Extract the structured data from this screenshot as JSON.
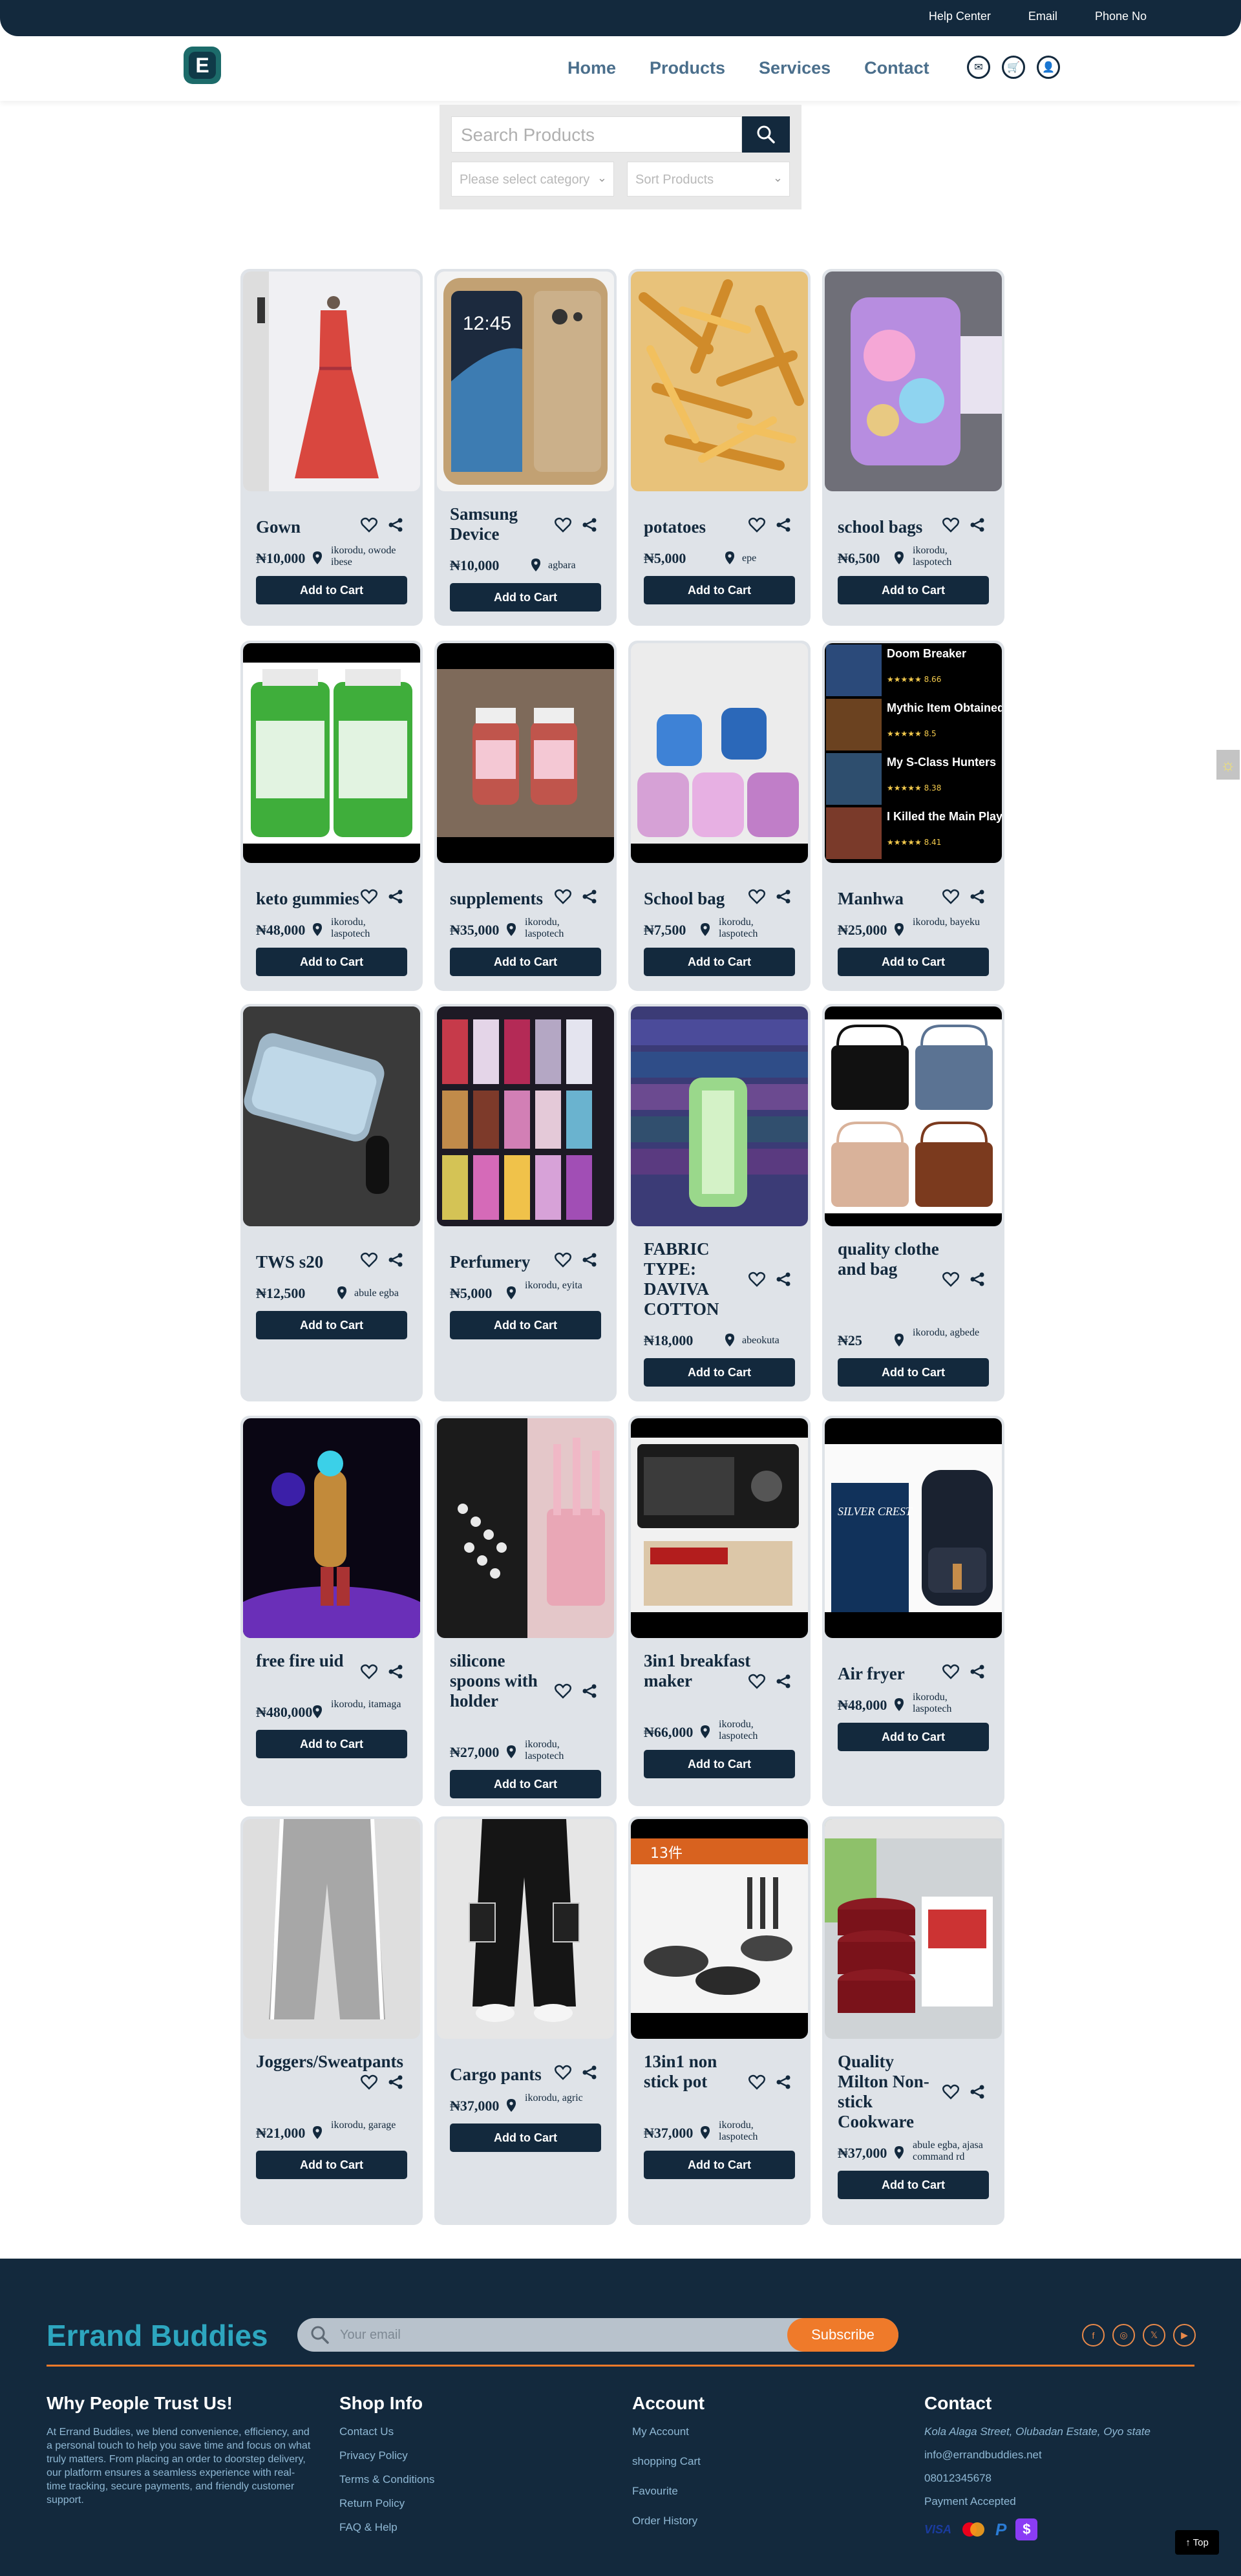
{
  "topbar": {
    "links": [
      "Help Center",
      "Email",
      "Phone No"
    ]
  },
  "nav": {
    "links": [
      "Home",
      "Products",
      "Services",
      "Contact"
    ]
  },
  "search": {
    "placeholder": "Search Products",
    "category_placeholder": "Please select category",
    "sort_placeholder": "Sort Products"
  },
  "products": [
    {
      "name": "Gown",
      "price": "₦10,000",
      "location": "ikorodu, owode ibese",
      "button": "Add to Cart",
      "image": "pink-floral-dress"
    },
    {
      "name": "Samsung Device",
      "price": "₦10,000",
      "location": "agbara",
      "button": "Add to Cart",
      "image": "gold-smartphone"
    },
    {
      "name": "potatoes",
      "price": "₦5,000",
      "location": "epe",
      "button": "Add to Cart",
      "image": "fried-potatoes"
    },
    {
      "name": "school bags",
      "price": "₦6,500",
      "location": "ikorodu, laspotech",
      "button": "Add to Cart",
      "image": "sparkly-school-bag"
    },
    {
      "name": "keto gummies",
      "price": "₦48,000",
      "location": "ikorodu, laspotech",
      "button": "Add to Cart",
      "image": "green-gummy-bottles"
    },
    {
      "name": "supplements",
      "price": "₦35,000",
      "location": "ikorodu, laspotech",
      "button": "Add to Cart",
      "image": "hair-gummy-bottles"
    },
    {
      "name": "School bag",
      "price": "₦7,500",
      "location": "ikorodu, laspotech",
      "button": "Add to Cart",
      "image": "kids-school-bags"
    },
    {
      "name": "Manhwa",
      "price": "₦25,000",
      "location": "ikorodu, bayeku",
      "button": "Add to Cart",
      "image": "manhwa-list"
    },
    {
      "name": "TWS s20",
      "price": "₦12,500",
      "location": "abule egba",
      "button": "Add to Cart",
      "image": "earbuds-case"
    },
    {
      "name": "Perfumery",
      "price": "₦5,000",
      "location": "ikorodu, eyita",
      "button": "Add to Cart",
      "image": "perfume-shelf"
    },
    {
      "name": "FABRIC TYPE: DAVIVA COTTON",
      "price": "₦18,000",
      "location": "abeokuta",
      "button": "Add to Cart",
      "image": "fabric-stack"
    },
    {
      "name": "quality clothe and bag",
      "price": "₦25",
      "location": "ikorodu, agbede",
      "button": "Add to Cart",
      "image": "handbags"
    },
    {
      "name": "free fire uid",
      "price": "₦480,000",
      "location": "ikorodu, itamaga",
      "button": "Add to Cart",
      "image": "game-character"
    },
    {
      "name": "silicone spoons with holder",
      "price": "₦27,000",
      "location": "ikorodu, laspotech",
      "button": "Add to Cart",
      "image": "silicone-utensils"
    },
    {
      "name": "3in1 breakfast maker",
      "price": "₦66,000",
      "location": "ikorodu, laspotech",
      "button": "Add to Cart",
      "image": "breakfast-maker"
    },
    {
      "name": "Air fryer",
      "price": "₦48,000",
      "location": "ikorodu, laspotech",
      "button": "Add to Cart",
      "image": "air-fryer"
    },
    {
      "name": "Joggers/Sweatpants",
      "price": "₦21,000",
      "location": "ikorodu, garage",
      "button": "Add to Cart",
      "image": "grey-joggers"
    },
    {
      "name": "Cargo pants",
      "price": "₦37,000",
      "location": "ikorodu, agric",
      "button": "Add to Cart",
      "image": "black-cargo-pants"
    },
    {
      "name": "13in1 non stick pot",
      "price": "₦37,000",
      "location": "ikorodu, laspotech",
      "button": "Add to Cart",
      "image": "cookware-set"
    },
    {
      "name": "Quality Milton Non-stick Cookware",
      "price": "₦37,000",
      "location": "abule egba, ajasa command rd",
      "button": "Add to Cart",
      "image": "red-cookware"
    }
  ],
  "manhwa_titles": [
    "Doom Breaker",
    "Mythic Item Obtained",
    "My S-Class Hunters",
    "I Killed the Main Player"
  ],
  "manhwa_ratings": [
    "8.66",
    "8.5",
    "8.38",
    "8.41"
  ],
  "footer": {
    "brand": "Errand Buddies",
    "email_placeholder": "Your email",
    "subscribe": "Subscribe",
    "trust_title": "Why People Trust Us!",
    "trust_text": "At Errand Buddies, we blend convenience, efficiency, and a personal touch to help you save time and focus on what truly matters. From placing an order to doorstep delivery, our platform ensures a seamless experience with real-time tracking, secure payments, and friendly customer support.",
    "shop_title": "Shop Info",
    "shop_links": [
      "Contact Us",
      "Privacy Policy",
      "Terms & Conditions",
      "Return Policy",
      "FAQ & Help"
    ],
    "account_title": "Account",
    "account_links": [
      "My Account",
      "shopping Cart",
      "Favourite",
      "Order History"
    ],
    "contact_title": "Contact",
    "address": "Kola Alaga Street, Olubadan Estate, Oyo state",
    "email": "info@errandbuddies.net",
    "phone": "08012345678",
    "payment_label": "Payment Accepted",
    "top_label": "↑ Top"
  },
  "colors": {
    "navy": "#13293d",
    "orange": "#ef7a2a",
    "teal": "#2da6bf",
    "card_bg": "#dfe3e8"
  }
}
